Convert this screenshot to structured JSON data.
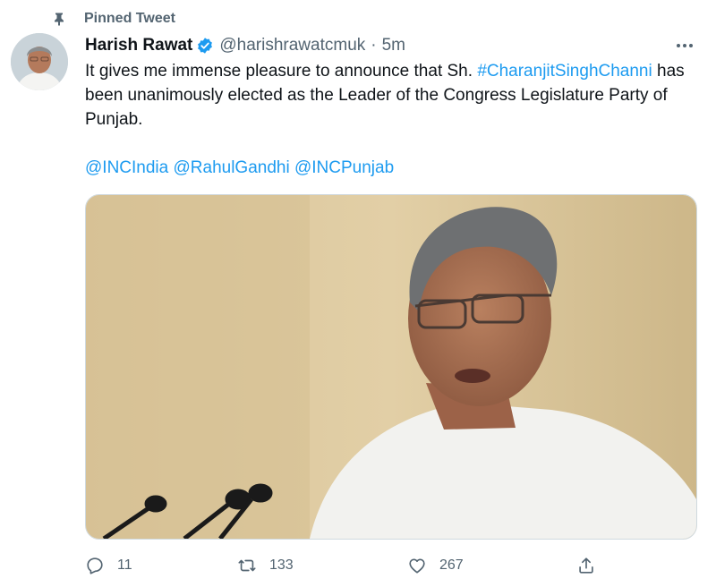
{
  "pinned": {
    "label": "Pinned Tweet"
  },
  "author": {
    "name": "Harish Rawat",
    "handle": "@harishrawatcmuk",
    "separator": "·",
    "time": "5m",
    "verified": true
  },
  "tweet": {
    "text_prefix": "It gives me immense pleasure to announce that Sh.",
    "hashtag": "#CharanjitSinghChanni",
    "text_suffix": "has been unanimously elected as the Leader of the Congress Legislature Party of Punjab.",
    "mentions": [
      "@INCIndia",
      "@RahulGandhi",
      "@INCPunjab"
    ]
  },
  "actions": {
    "reply_count": "11",
    "retweet_count": "133",
    "like_count": "267"
  },
  "icons": {
    "pin": "pin-icon",
    "verified": "verified-badge-icon",
    "more": "more-horizontal-icon",
    "reply": "reply-icon",
    "retweet": "retweet-icon",
    "like": "heart-icon",
    "share": "share-icon"
  },
  "colors": {
    "accent": "#1d9bf0",
    "secondary_text": "#536471",
    "primary_text": "#0f1419"
  }
}
